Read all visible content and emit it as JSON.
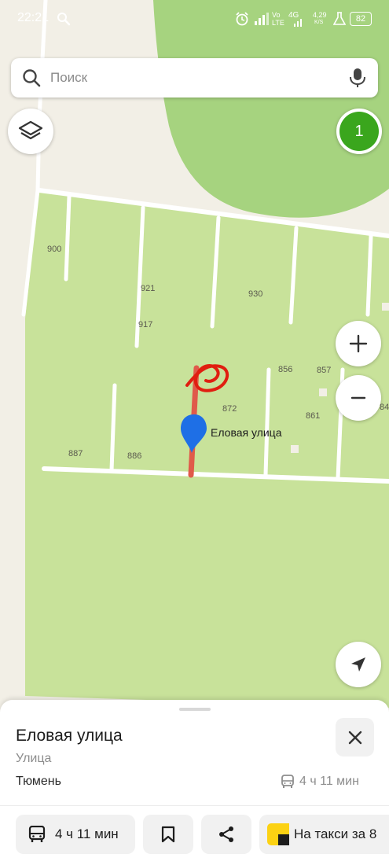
{
  "status_bar": {
    "time": "22:21",
    "network_label": "Vo LTE",
    "network_type": "4G",
    "speed_value": "4,29",
    "speed_unit": "K/S",
    "battery": "82"
  },
  "search": {
    "placeholder": "Поиск"
  },
  "map": {
    "badge_count": "1",
    "street_label": "Еловая улица",
    "plot_numbers": [
      "900",
      "921",
      "917",
      "930",
      "856",
      "857",
      "872",
      "861",
      "887",
      "886",
      "84"
    ],
    "colors": {
      "park": "#c8e29a",
      "forest": "#a6d37f",
      "background": "#f2efe6",
      "road": "#ffffff",
      "route": "#e05a4a",
      "pin": "#1e6fe6",
      "scribble": "#e01e10"
    }
  },
  "place_card": {
    "title": "Еловая улица",
    "subtitle": "Улица",
    "city": "Тюмень",
    "transit_time": "4 ч 11 мин"
  },
  "actions": {
    "route_time": "4 ч 11 мин",
    "taxi_label": "На такси за 8"
  },
  "icons": [
    "search-icon",
    "microphone-icon",
    "layers-icon",
    "zoom-in-icon",
    "zoom-out-icon",
    "location-arrow-icon",
    "close-icon",
    "bus-icon",
    "bookmark-icon",
    "share-icon",
    "taxi-icon"
  ]
}
